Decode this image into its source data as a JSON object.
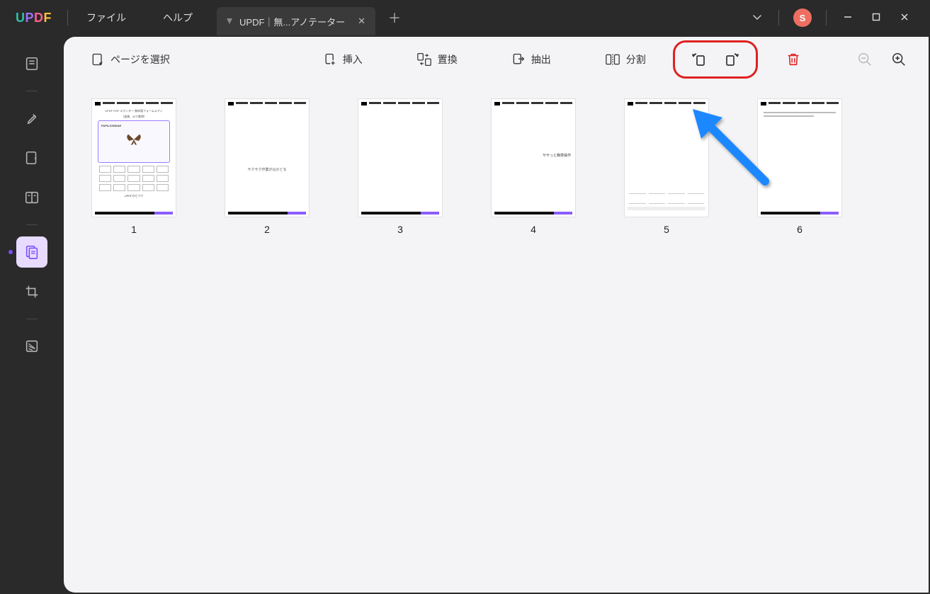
{
  "app": {
    "logo": "UPDF"
  },
  "menu": {
    "file": "ファイル",
    "help": "ヘルプ"
  },
  "tab": {
    "title": "UPDF｜無...アノテーター"
  },
  "avatar": {
    "initial": "S"
  },
  "toolbar": {
    "select_pages": "ページを選択",
    "insert": "挿入",
    "replace": "置換",
    "extract": "抽出",
    "split": "分割"
  },
  "pages": {
    "p1": {
      "num": "1",
      "title": "UPDF PDF エディター 無料版フォームエディ",
      "sub": "（画像、AIで質問）",
      "foot": "UPDFひとつで"
    },
    "p2": {
      "num": "2",
      "text": "サクサク作業がはかどる"
    },
    "p3": {
      "num": "3"
    },
    "p4": {
      "num": "4",
      "text": "ササっと簡単操作"
    },
    "p5": {
      "num": "5"
    },
    "p6": {
      "num": "6"
    }
  }
}
